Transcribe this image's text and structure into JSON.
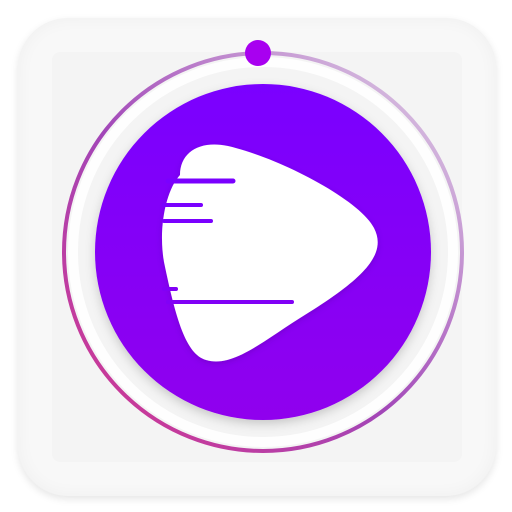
{
  "app_icon": {
    "icon": "play-button-icon",
    "progress": 0.0,
    "colors": {
      "tile": "#f8f8f8",
      "disc_top": "#7a00ff",
      "disc_bottom": "#9000ee",
      "ring_left": "#d8348c",
      "ring_mid": "#a246b8",
      "ring_right": "#e3dbe9",
      "knob": "#a800f0",
      "play_shape": "#ffffff"
    }
  }
}
